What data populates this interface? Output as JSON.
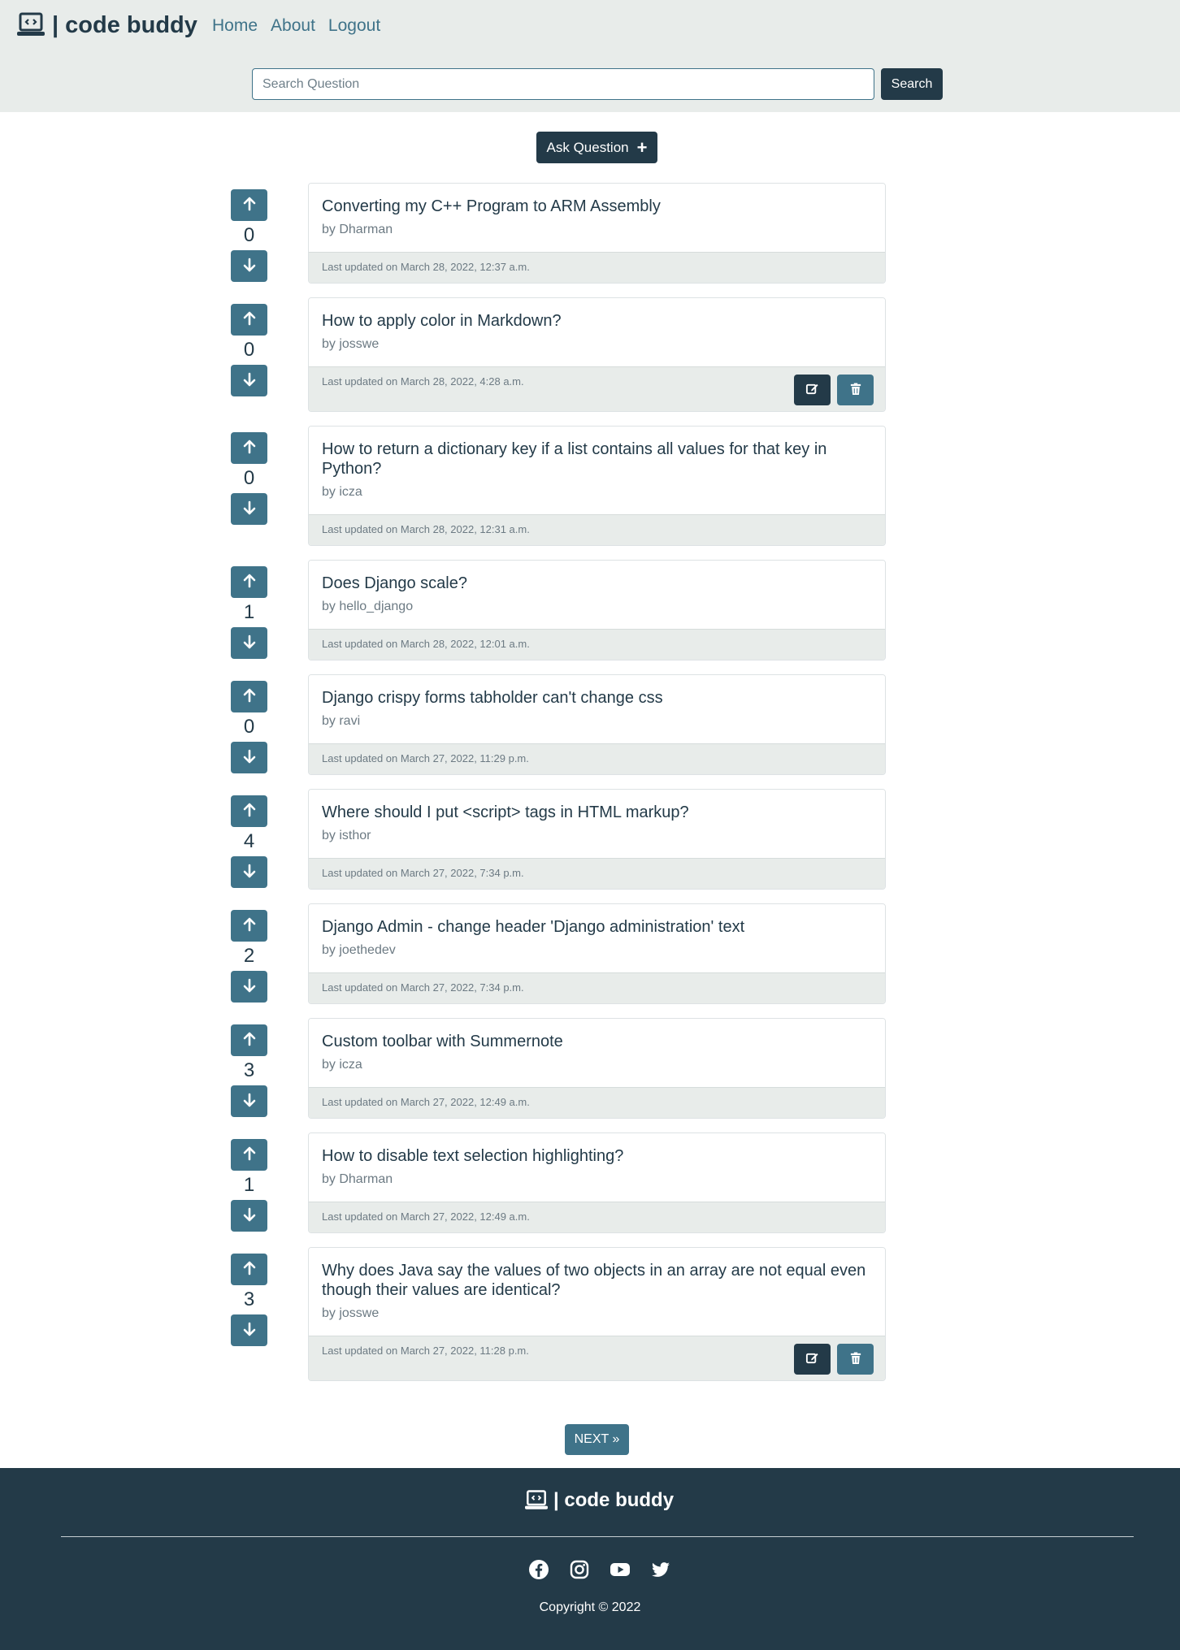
{
  "header": {
    "brand": "| code buddy",
    "nav": {
      "home": "Home",
      "about": "About",
      "logout": "Logout"
    },
    "search": {
      "placeholder": "Search Question",
      "button": "Search"
    }
  },
  "ask_button": "Ask Question",
  "questions": [
    {
      "votes": "0",
      "title": "Converting my C++ Program to ARM Assembly",
      "author": "by Dharman",
      "updated": "Last updated on March 28, 2022, 12:37 a.m.",
      "owner": false
    },
    {
      "votes": "0",
      "title": "How to apply color in Markdown?",
      "author": "by josswe",
      "updated": "Last updated on March 28, 2022, 4:28 a.m.",
      "owner": true
    },
    {
      "votes": "0",
      "title": "How to return a dictionary key if a list contains all values for that key in Python?",
      "author": "by icza",
      "updated": "Last updated on March 28, 2022, 12:31 a.m.",
      "owner": false
    },
    {
      "votes": "1",
      "title": "Does Django scale?",
      "author": "by hello_django",
      "updated": "Last updated on March 28, 2022, 12:01 a.m.",
      "owner": false
    },
    {
      "votes": "0",
      "title": "Django crispy forms tabholder can't change css",
      "author": "by ravi",
      "updated": "Last updated on March 27, 2022, 11:29 p.m.",
      "owner": false
    },
    {
      "votes": "4",
      "title": "Where should I put <script> tags in HTML markup?",
      "author": "by isthor",
      "updated": "Last updated on March 27, 2022, 7:34 p.m.",
      "owner": false
    },
    {
      "votes": "2",
      "title": "Django Admin - change header 'Django administration' text",
      "author": "by joethedev",
      "updated": "Last updated on March 27, 2022, 7:34 p.m.",
      "owner": false
    },
    {
      "votes": "3",
      "title": "Custom toolbar with Summernote",
      "author": "by icza",
      "updated": "Last updated on March 27, 2022, 12:49 a.m.",
      "owner": false
    },
    {
      "votes": "1",
      "title": "How to disable text selection highlighting?",
      "author": "by Dharman",
      "updated": "Last updated on March 27, 2022, 12:49 a.m.",
      "owner": false
    },
    {
      "votes": "3",
      "title": "Why does Java say the values of two objects in an array are not equal even though their values are identical?",
      "author": "by josswe",
      "updated": "Last updated on March 27, 2022, 11:28 p.m.",
      "owner": true
    }
  ],
  "pagination": {
    "next": "NEXT »"
  },
  "footer": {
    "brand": "| code buddy",
    "socials": [
      "facebook-icon",
      "instagram-icon",
      "youtube-icon",
      "twitter-icon"
    ],
    "copyright": "Copyright © 2022"
  },
  "colors": {
    "dark": "#233a48",
    "accent": "#3f7389",
    "light_bg": "#e8ecea"
  }
}
